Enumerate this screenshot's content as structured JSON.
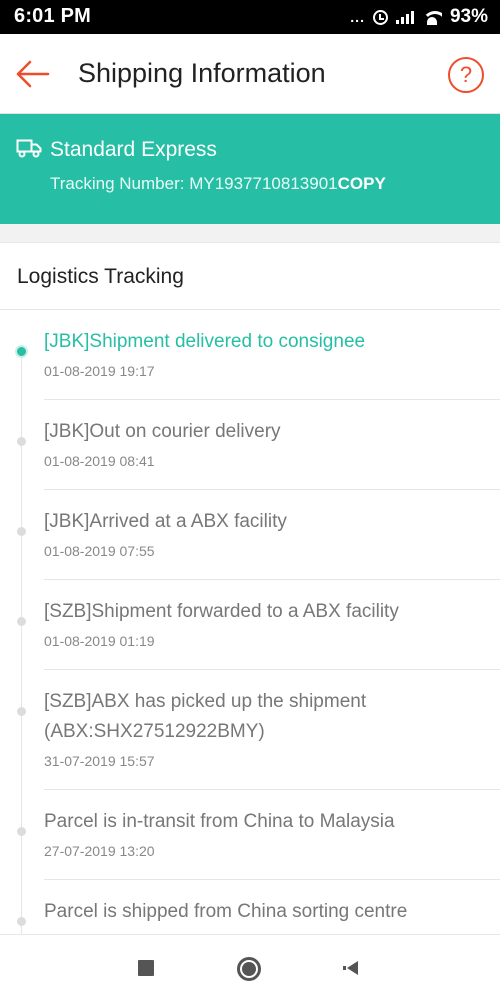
{
  "status_bar": {
    "time": "6:01 PM",
    "dots": "...",
    "battery": "93%"
  },
  "header": {
    "title": "Shipping Information",
    "help_label": "?"
  },
  "shipping": {
    "method": "Standard Express",
    "tracking_label": "Tracking Number: ",
    "tracking_number": "MY1937710813901",
    "copy_label": "COPY"
  },
  "logistics": {
    "title": "Logistics Tracking",
    "events": [
      {
        "description": "[JBK]Shipment delivered to consignee",
        "time": "01-08-2019 19:17",
        "active": true
      },
      {
        "description": "[JBK]Out on courier delivery",
        "time": "01-08-2019 08:41",
        "active": false
      },
      {
        "description": "[JBK]Arrived at a ABX facility",
        "time": "01-08-2019 07:55",
        "active": false
      },
      {
        "description": "[SZB]Shipment forwarded to a ABX facility",
        "time": "01-08-2019 01:19",
        "active": false
      },
      {
        "description": "[SZB]ABX has picked up the shipment (ABX:SHX27512922BMY)",
        "time": "31-07-2019 15:57",
        "active": false
      },
      {
        "description": "Parcel is in-transit from China to Malaysia",
        "time": "27-07-2019 13:20",
        "active": false
      },
      {
        "description": "Parcel is shipped from China sorting centre",
        "time": "",
        "active": false
      }
    ]
  },
  "colors": {
    "accent": "#26bfa5",
    "brand": "#ee4d2d"
  },
  "icons": {
    "back": "arrow-left-icon",
    "help": "question-circle-icon",
    "truck": "truck-icon"
  }
}
